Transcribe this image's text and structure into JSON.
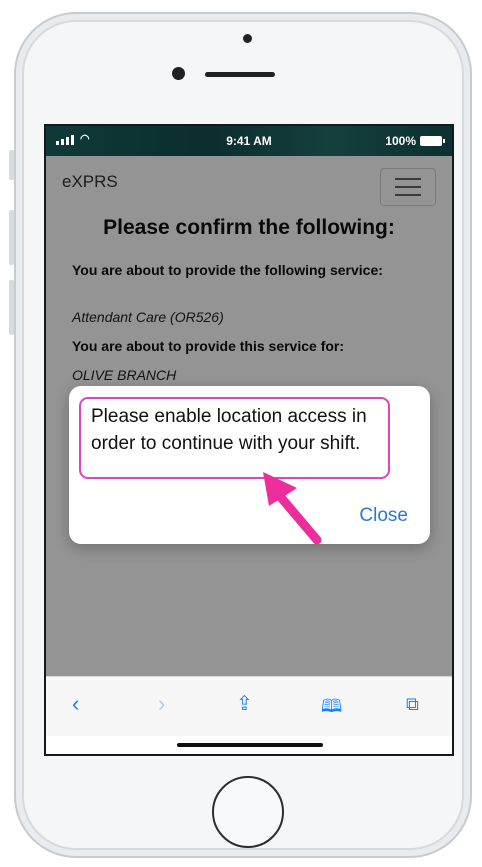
{
  "status_bar": {
    "time": "9:41 AM",
    "battery": "100%"
  },
  "app": {
    "brand": "eXPRS"
  },
  "confirm": {
    "title": "Please confirm the following:",
    "service_label": "You are about to provide the following service:",
    "service_value": "Attendant Care (OR526)",
    "client_label": "You are about to provide this service for:",
    "client_value": "OLIVE BRANCH"
  },
  "alert": {
    "message": "Please enable location access in order to continue with your shift.",
    "close_label": "Close"
  },
  "toolbar": {
    "back_icon": "chevron-left-icon",
    "forward_icon": "chevron-right-icon",
    "share_icon": "share-icon",
    "bookmarks_icon": "book-icon",
    "tabs_icon": "tabs-icon"
  },
  "colors": {
    "accent": "#1a82f7",
    "highlight": "#d946c3",
    "arrow": "#ee2d9c"
  }
}
